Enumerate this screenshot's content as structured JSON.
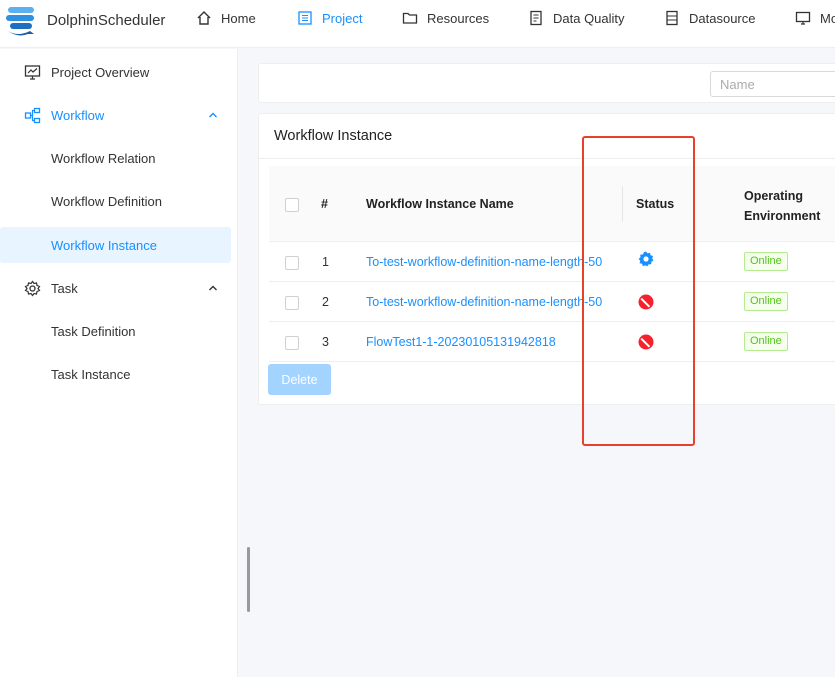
{
  "app": {
    "name": "DolphinScheduler"
  },
  "nav": [
    {
      "label": "Home",
      "icon": "home-icon"
    },
    {
      "label": "Project",
      "icon": "project-icon",
      "active": true
    },
    {
      "label": "Resources",
      "icon": "folder-icon"
    },
    {
      "label": "Data Quality",
      "icon": "data-quality-icon"
    },
    {
      "label": "Datasource",
      "icon": "datasource-icon"
    },
    {
      "label": "Mo",
      "icon": "monitor-icon"
    }
  ],
  "sidebar": {
    "items": [
      {
        "label": "Project Overview",
        "icon": "project-overview-icon"
      },
      {
        "label": "Workflow",
        "icon": "workflow-icon",
        "expanded": true
      },
      {
        "label": "Workflow Relation"
      },
      {
        "label": "Workflow Definition"
      },
      {
        "label": "Workflow Instance",
        "selected": true
      },
      {
        "label": "Task",
        "icon": "gear-icon",
        "expanded": true
      },
      {
        "label": "Task Definition"
      },
      {
        "label": "Task Instance"
      }
    ]
  },
  "filter": {
    "name_placeholder": "Name"
  },
  "main": {
    "title": "Workflow Instance",
    "columns": [
      "#",
      "Workflow Instance Name",
      "Status",
      "Operating Environment"
    ],
    "rows": [
      {
        "num": "1",
        "name": "To-test-workflow-definition-name-length-50",
        "status": "running",
        "env": "Online"
      },
      {
        "num": "2",
        "name": "To-test-workflow-definition-name-length-50",
        "status": "failed",
        "env": "Online"
      },
      {
        "num": "3",
        "name": "FlowTest1-1-20230105131942818",
        "status": "failed",
        "env": "Online"
      }
    ],
    "delete_label": "Delete"
  },
  "colors": {
    "accent": "#1890ff",
    "status_running": "#1890ff",
    "status_failed": "#f5222d",
    "online": "#52c41a",
    "highlight": "#e8402a"
  }
}
